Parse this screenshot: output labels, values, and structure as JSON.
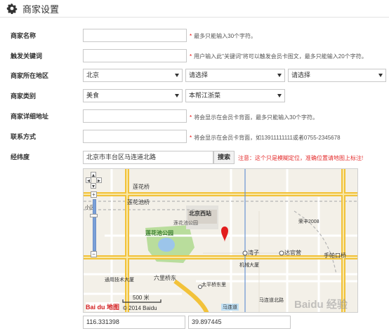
{
  "header": {
    "title": "商家设置",
    "icon": "gear-icon"
  },
  "form": {
    "name": {
      "label": "商家名称",
      "value": "",
      "hint": "最多只能输入30个字符。"
    },
    "keyword": {
      "label": "触发关键词",
      "value": "",
      "hint": "用户输入此\"关键词\"将可以触发会员卡图文，最多只能输入20个字符。"
    },
    "region": {
      "label": "商家所在地区",
      "province": "北京",
      "city": "请选择",
      "district": "请选择"
    },
    "category": {
      "label": "商家类别",
      "main": "美食",
      "sub": "本帮江浙菜"
    },
    "address": {
      "label": "商家详细地址",
      "value": "",
      "hint": "将会显示在会员卡背面，最多只能输入30个字符。"
    },
    "contact": {
      "label": "联系方式",
      "value": "",
      "hint": "将会显示在会员卡背面，如13911111111或者0755-2345678"
    },
    "coords": {
      "label": "经纬度",
      "search_value": "北京市丰台区马连道北路",
      "search_button": "搜索",
      "note": "注意：这个只是模糊定位，准确位置请地图上标注!",
      "longitude": "116.331398",
      "latitude": "39.897445"
    }
  },
  "map": {
    "labels": {
      "lianhuaqiao": "莲花桥",
      "lianhuachiqiao": "莲花池桥",
      "beijingxizhan": "北京西站",
      "lianhuachigongyuan_n": "莲花池公园",
      "lianhuachigongyuan": "莲花池公园",
      "longrong2008": "荣丰2008",
      "wanzi": "湾子",
      "daguanying": "达官营",
      "shoupakouqiao": "手帕口桥",
      "jixietower": "机械大厦",
      "liulitun": "六里桥东",
      "taipingqiao": "太平桥东里",
      "malian": "马连道",
      "malianroad": "马连道北路",
      "tongyongtower": "通用技术大厦",
      "xiaoyi": "小区"
    },
    "scale": "500 米",
    "copyright": "© 2014 Baidu",
    "logo": "Bai du 地图",
    "watermark": "Baidu 经验"
  }
}
